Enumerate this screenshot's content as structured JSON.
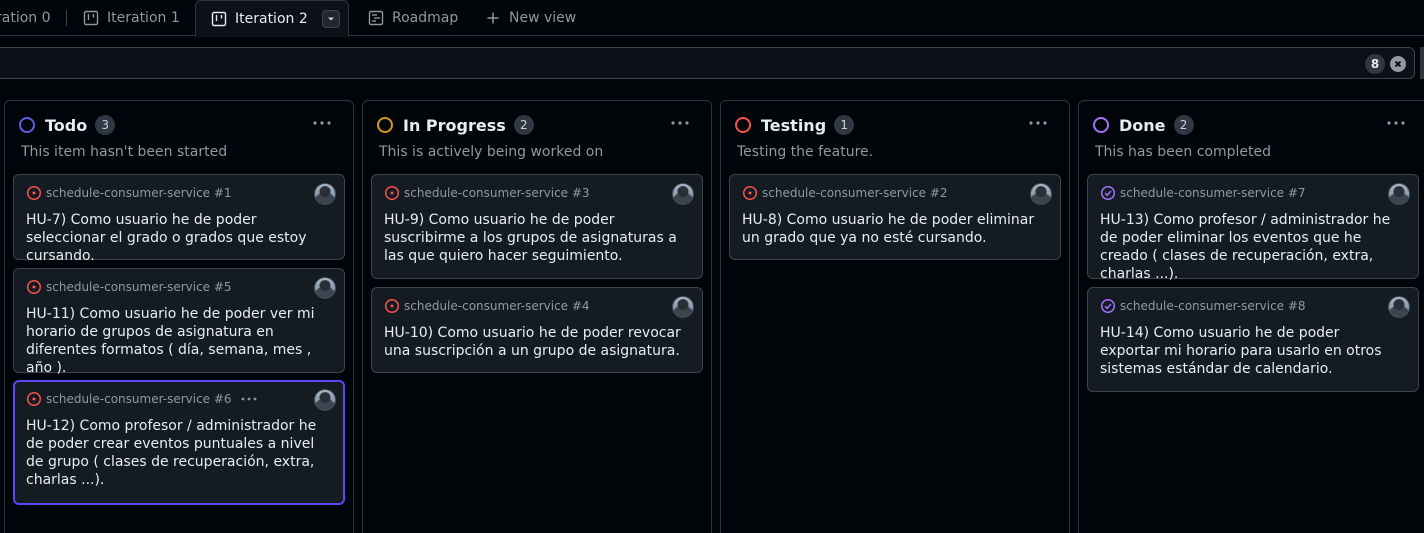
{
  "tabs": [
    {
      "label": "ration 0",
      "icon": "table-icon"
    },
    {
      "label": "Iteration 1",
      "icon": "board-icon"
    },
    {
      "label": "Iteration 2",
      "icon": "board-icon",
      "active": true
    },
    {
      "label": "Roadmap",
      "icon": "roadmap-icon"
    },
    {
      "label": "New view",
      "icon": "plus-icon"
    }
  ],
  "filter": {
    "count": "8"
  },
  "columns": [
    {
      "title": "Todo",
      "count": "3",
      "description": "This item hasn't been started",
      "color": "#5a5fe8",
      "cards": [
        {
          "ref": "schedule-consumer-service #1",
          "title": "HU-7) Como usuario he de poder seleccionar el grado o grados que estoy cursando.",
          "status": "open"
        },
        {
          "ref": "schedule-consumer-service #5",
          "title": "HU-11) Como usuario he de poder ver mi horario de grupos de asignatura en diferentes formatos ( día, semana, mes , año ).",
          "status": "open"
        },
        {
          "ref": "schedule-consumer-service #6",
          "title": "HU-12) Como profesor / administrador he de poder crear eventos puntuales a nivel de grupo ( clases de recuperación, extra, charlas ...).",
          "status": "open"
        }
      ]
    },
    {
      "title": "In Progress",
      "count": "2",
      "description": "This is actively being worked on",
      "color": "#d29922",
      "cards": [
        {
          "ref": "schedule-consumer-service #3",
          "title": "HU-9) Como usuario he de poder suscribirme a los grupos de asignaturas a las que quiero hacer seguimiento.",
          "status": "open"
        },
        {
          "ref": "schedule-consumer-service #4",
          "title": "HU-10) Como usuario he de poder revocar una suscripción a un grupo de asignatura.",
          "status": "open"
        }
      ]
    },
    {
      "title": "Testing",
      "count": "1",
      "description": "Testing the feature.",
      "color": "#f85149",
      "cards": [
        {
          "ref": "schedule-consumer-service #2",
          "title": "HU-8) Como usuario he de poder eliminar un grado que ya no esté cursando.",
          "status": "open"
        }
      ]
    },
    {
      "title": "Done",
      "count": "2",
      "description": "This has been completed",
      "color": "#a371f7",
      "cards": [
        {
          "ref": "schedule-consumer-service #7",
          "title": "HU-13) Como profesor / administrador he de poder eliminar los eventos que he creado ( clases de recuperación, extra, charlas ...).",
          "status": "closed"
        },
        {
          "ref": "schedule-consumer-service #8",
          "title": "HU-14) Como usuario he de poder exportar mi horario para usarlo en otros sistemas estándar de calendario.",
          "status": "closed"
        }
      ]
    }
  ],
  "colors": {
    "open": "#f85149",
    "closed": "#a371f7",
    "selected_border": "#5a48f5"
  }
}
